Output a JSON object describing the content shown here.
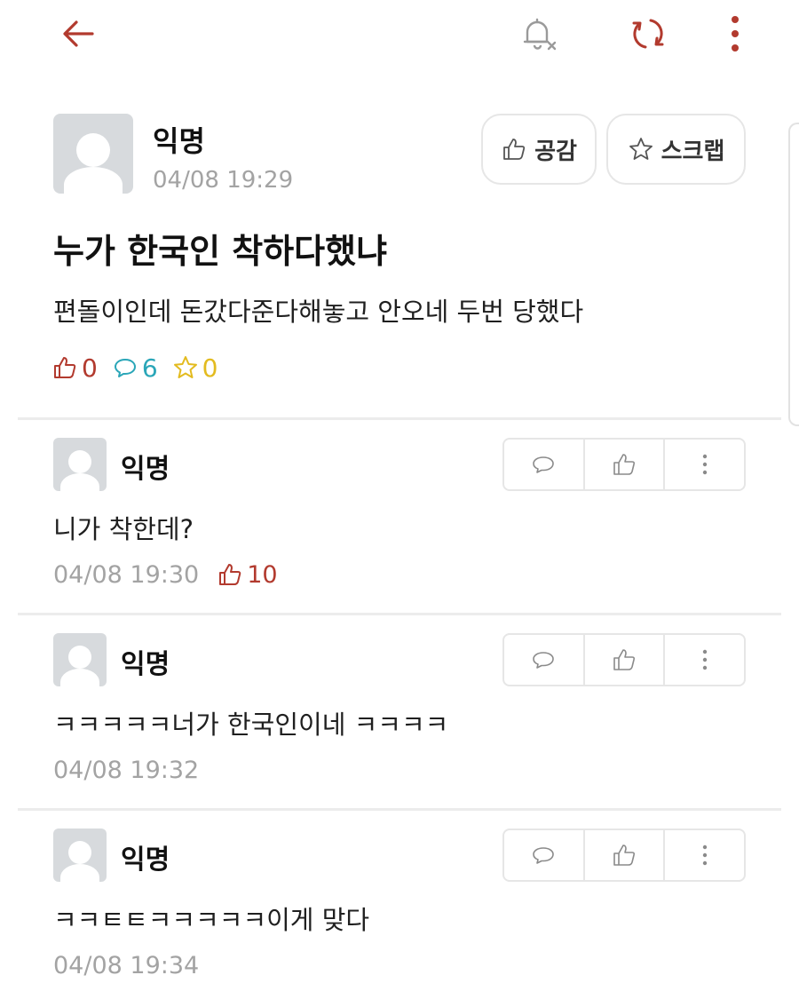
{
  "colors": {
    "accent": "#b23a2e",
    "comment_stat": "#2aa6b8",
    "scrap_stat": "#e3bb1f",
    "muted": "#a3a3a3"
  },
  "header": {
    "back_icon": "arrow-left-icon",
    "notification_icon": "bell-off-icon",
    "refresh_icon": "refresh-icon",
    "menu_icon": "vertical-dots-icon"
  },
  "post": {
    "author": "익명",
    "date": "04/08 19:29",
    "like_button_label": "공감",
    "scrap_button_label": "스크랩",
    "title": "누가 한국인 착하다했냐",
    "body": "편돌이인데 돈갔다준다해놓고 안오네 두번 당했다",
    "stats": {
      "likes": "0",
      "comments": "6",
      "scraps": "0"
    }
  },
  "comments": [
    {
      "author": "익명",
      "text": "니가 착한데?",
      "date": "04/08 19:30",
      "likes": "10"
    },
    {
      "author": "익명",
      "text": "ㅋㅋㅋㅋㅋ너가 한국인이네 ㅋㅋㅋㅋ",
      "date": "04/08 19:32",
      "likes": ""
    },
    {
      "author": "익명",
      "text": "ㅋㅋㅌㅌㅋㅋㅋㅋㅋ이게 맞다",
      "date": "04/08 19:34",
      "likes": ""
    }
  ]
}
